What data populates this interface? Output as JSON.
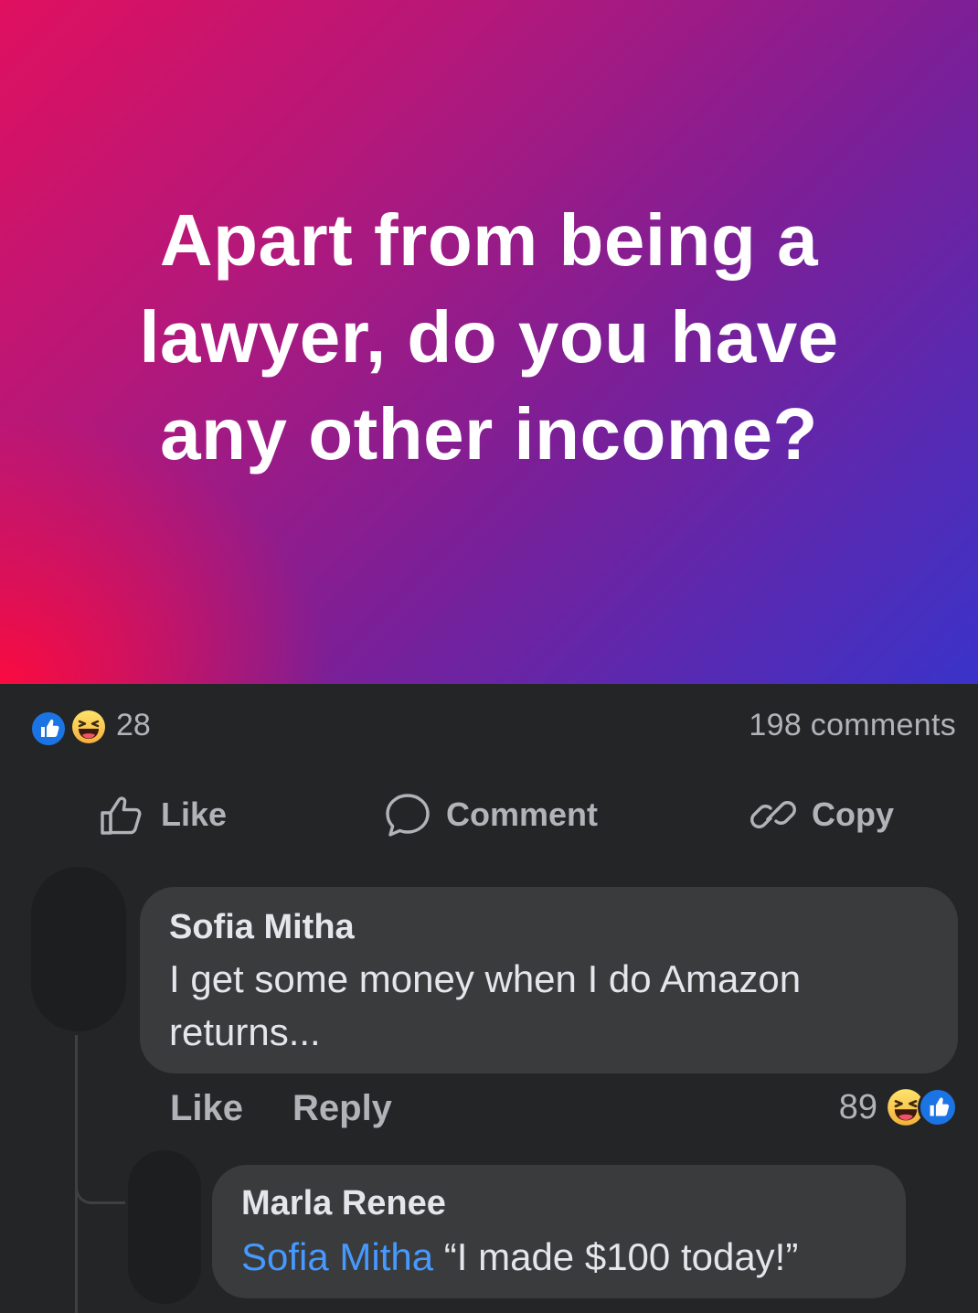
{
  "post": {
    "text": "Apart from being a lawyer, do you have any other income?",
    "gradient_colors": [
      "#e0105f",
      "#7b1f97",
      "#3a33c9"
    ]
  },
  "stats": {
    "reaction_count": "28",
    "comments_label": "198 comments",
    "reaction_icons": [
      "like-icon",
      "haha-icon"
    ]
  },
  "actions": {
    "like_label": "Like",
    "comment_label": "Comment",
    "copy_label": "Copy"
  },
  "comments": [
    {
      "author": "Sofia Mitha",
      "text": "I get some money when I do Amazon returns...",
      "like_label": "Like",
      "reply_label": "Reply",
      "reaction_count": "89",
      "reaction_icons": [
        "haha-icon",
        "like-icon"
      ]
    },
    {
      "author": "Marla Renee",
      "mention": "Sofia Mitha",
      "text": "“I made $100 today!”"
    }
  ],
  "colors": {
    "background": "#242526",
    "bubble": "#3a3b3c",
    "text_primary": "#e4e6eb",
    "text_secondary": "#b0b3b8",
    "mention": "#4599ff",
    "like_blue": "#1b74e4"
  }
}
